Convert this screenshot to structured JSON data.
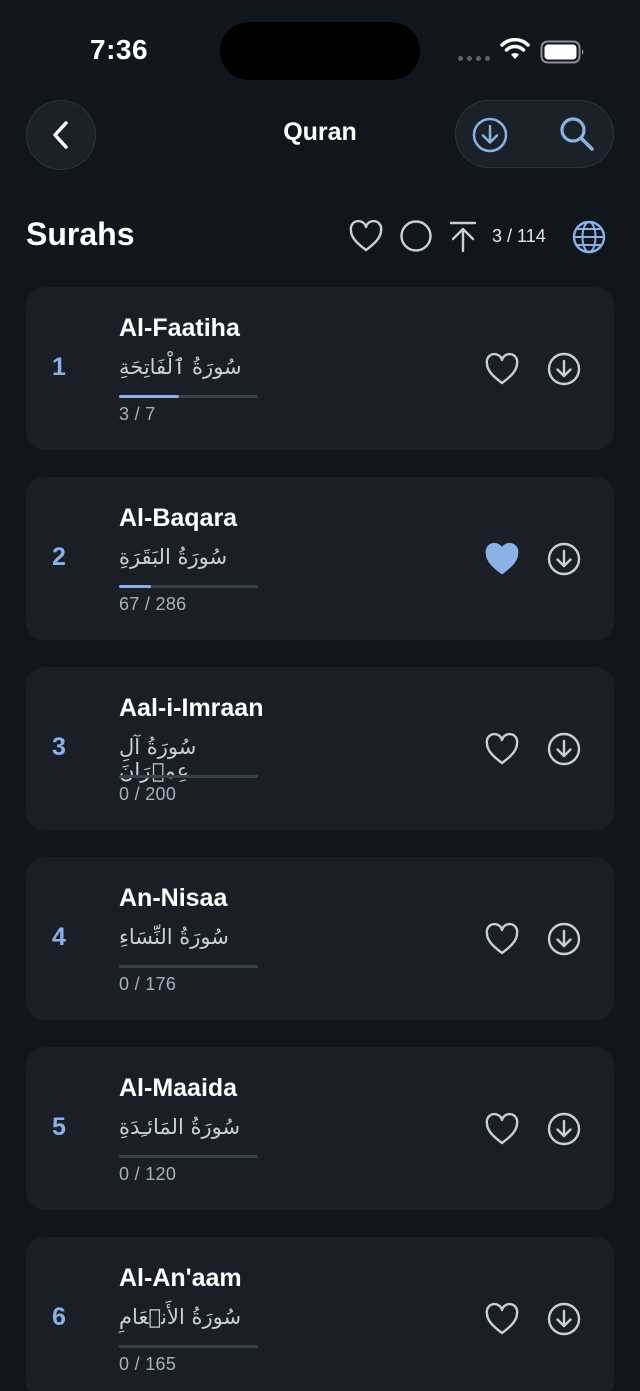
{
  "status_bar": {
    "time": "7:36"
  },
  "nav": {
    "title": "Quran"
  },
  "header": {
    "title": "Surahs",
    "progress": "3 / 114"
  },
  "colors": {
    "accent": "#8ab2e6",
    "background": "#11161d",
    "card": "#1a1f27"
  },
  "surahs": [
    {
      "number": "1",
      "name": "Al-Faatiha",
      "arabic": "سُورَةُ ٱلْفَاتِحَةِ",
      "verses": "3 / 7",
      "progress": 0.43,
      "favorite": false
    },
    {
      "number": "2",
      "name": "Al-Baqara",
      "arabic": "سُورَةُ البَقَرَةِ",
      "verses": "67 / 286",
      "progress": 0.23,
      "favorite": true
    },
    {
      "number": "3",
      "name": "Aal-i-Imraan",
      "arabic": "سُورَةُ آلِ عِمۡرَانَ",
      "verses": "0 / 200",
      "progress": 0,
      "favorite": false
    },
    {
      "number": "4",
      "name": "An-Nisaa",
      "arabic": "سُورَةُ النِّسَاءِ",
      "verses": "0 / 176",
      "progress": 0,
      "favorite": false
    },
    {
      "number": "5",
      "name": "Al-Maaida",
      "arabic": "سُورَةُ المَائـِدَةِ",
      "verses": "0 / 120",
      "progress": 0,
      "favorite": false
    },
    {
      "number": "6",
      "name": "Al-An'aam",
      "arabic": "سُورَةُ الأَنۡعَامِ",
      "verses": "0 / 165",
      "progress": 0,
      "favorite": false
    }
  ]
}
